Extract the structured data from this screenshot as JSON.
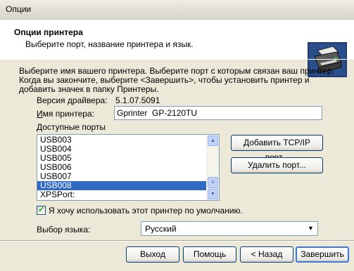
{
  "window": {
    "title": "Опции"
  },
  "header": {
    "title": "Опции принтера",
    "subtitle": "Выберите порт, название принтера и язык.",
    "icon": "printer-icon"
  },
  "instructions": "Выберите имя вашего принтера. Выберите порт с которым связан ваш принтер. Когда вы закончите, выберите <Завершить>, чтобы установить принтер и добавить значек в папку Принтеры.",
  "driver": {
    "label": "Версия драйвера:",
    "value": "5.1.07.5091"
  },
  "printer_name": {
    "label": "Имя принтера:",
    "value": "Gprinter  GP-2120TU"
  },
  "ports": {
    "label": "Доступные порты",
    "items": [
      "USB003",
      "USB004",
      "USB005",
      "USB006",
      "USB007",
      "USB008",
      "XPSPort:"
    ],
    "selected": "USB008"
  },
  "buttons": {
    "add_tcpip": "Добавить TCP/IP порт...",
    "delete_port": "Удалить порт...",
    "exit": "Выход",
    "help": "Помощь",
    "back": "< Назад",
    "finish": "Завершить"
  },
  "default_printer": {
    "label": "Я хочу использовать этот принтер по умолчанию.",
    "checked": true
  },
  "language": {
    "label": "Выбор языка:",
    "value": "Русский"
  },
  "colors": {
    "selection": "#316AC5",
    "dialog_bg": "#ECE9D8",
    "default_button_border": "#3D76D8"
  }
}
